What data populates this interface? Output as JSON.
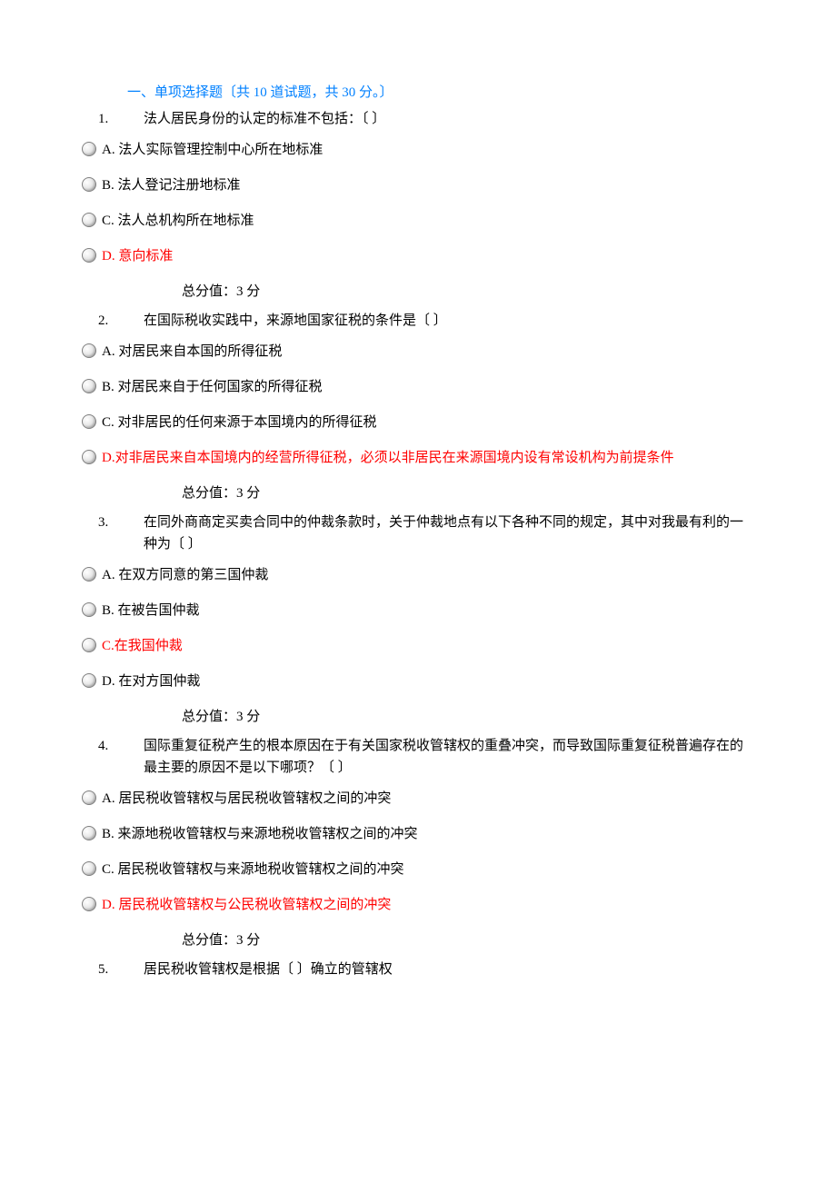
{
  "section_header": "一、单项选择题〔共    10    道试题，共    30    分。〕",
  "score_label": "总分值：3        分",
  "questions": [
    {
      "number": "1.",
      "text": "法人居民身份的认定的标准不包括：〔    〕",
      "options": [
        {
          "label": "A.  法人实际管理控制中心所在地标准",
          "highlighted": false
        },
        {
          "label": "B.  法人登记注册地标准",
          "highlighted": false
        },
        {
          "label": "C.  法人总机构所在地标准",
          "highlighted": false
        },
        {
          "label": "D.  意向标准",
          "highlighted": true
        }
      ]
    },
    {
      "number": "2.",
      "text": "在国际税收实践中，来源地国家征税的条件是〔    〕",
      "options": [
        {
          "label": "A.  对居民来自本国的所得征税",
          "highlighted": false
        },
        {
          "label": "B.  对居民来自于任何国家的所得征税",
          "highlighted": false
        },
        {
          "label": "C.  对非居民的任何来源于本国境内的所得征税",
          "highlighted": false
        },
        {
          "label": "D.对非居民来自本国境内的经营所得征税，必须以非居民在来源国境内设有常设机构为前提条件",
          "highlighted": true
        }
      ]
    },
    {
      "number": "3.",
      "text": "在同外商商定买卖合同中的仲裁条款时，关于仲裁地点有以下各种不同的规定，其中对我最有利的一种为〔    〕",
      "options": [
        {
          "label": "A.  在双方同意的第三国仲裁",
          "highlighted": false
        },
        {
          "label": "B.  在被告国仲裁",
          "highlighted": false
        },
        {
          "label": "C.在我国仲裁",
          "highlighted": true
        },
        {
          "label": "D.  在对方国仲裁",
          "highlighted": false
        }
      ]
    },
    {
      "number": "4.",
      "text": "国际重复征税产生的根本原因在于有关国家税收管辖权的重叠冲突，而导致国际重复征税普遍存在的最主要的原因不是以下哪项？〔    〕",
      "options": [
        {
          "label": "A.  居民税收管辖权与居民税收管辖权之间的冲突",
          "highlighted": false
        },
        {
          "label": "B.  来源地税收管辖权与来源地税收管辖权之间的冲突",
          "highlighted": false
        },
        {
          "label": "C.  居民税收管辖权与来源地税收管辖权之间的冲突",
          "highlighted": false
        },
        {
          "label": "D.  居民税收管辖权与公民税收管辖权之间的冲突",
          "highlighted": true
        }
      ]
    },
    {
      "number": "5.",
      "text": "居民税收管辖权是根据〔    〕确立的管辖权",
      "options": []
    }
  ]
}
